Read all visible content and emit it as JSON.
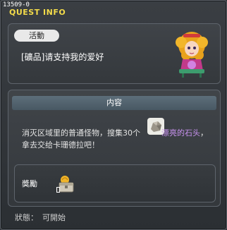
{
  "quest_id": "13509-0",
  "window_title": "QUEST INFO",
  "quest": {
    "tag": "活動",
    "name": "[礦品]请支持我的爱好"
  },
  "content": {
    "header": "内容",
    "desc_before": "消灭区域里的普通怪物，搜集30个",
    "item_name": "漂亮的石头",
    "desc_after": "，拿去交给卡珊德拉吧！"
  },
  "reward": {
    "label": "奬勵",
    "icon": "treasure-box-icon"
  },
  "status": {
    "label": "狀態：",
    "value": "可開始"
  },
  "colors": {
    "title": "#f4dc4a",
    "item_highlight": "#c892f0"
  }
}
